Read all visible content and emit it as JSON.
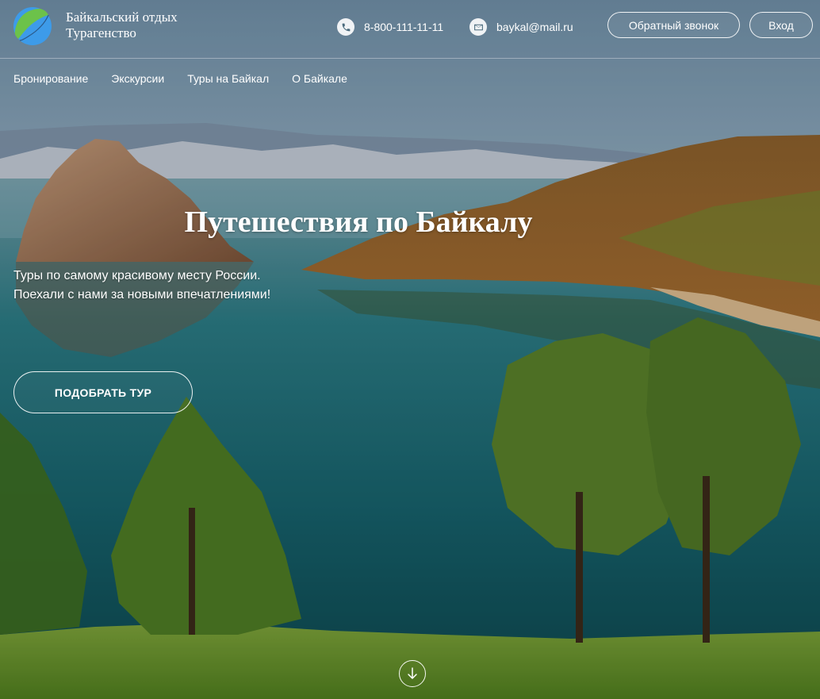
{
  "header": {
    "brand_line1": "Байкальский отдых",
    "brand_line2": "Турагенство",
    "phone": "8-800-111-11-11",
    "email": "baykal@mail.ru",
    "callback_label": "Обратный звонок",
    "login_label": "Вход",
    "icons": {
      "logo": "logo-icon",
      "phone": "phone-icon",
      "email": "email-icon"
    }
  },
  "nav": {
    "items": [
      {
        "label": "Бронирование"
      },
      {
        "label": "Экскурсии"
      },
      {
        "label": "Туры на Байкал"
      },
      {
        "label": "О Байкале"
      }
    ]
  },
  "hero": {
    "title": "Путешествия по Байкалу",
    "subtitle_line1": "Туры по самому красивому месту России.",
    "subtitle_line2": "Поехали с нами за новыми впечатлениями!",
    "cta_label": "ПОДОБРАТЬ ТУР",
    "scroll_icon": "arrow-down-icon"
  },
  "colors": {
    "logo_green": "#6cc24a",
    "logo_blue": "#3d9be9",
    "text": "#ffffff",
    "water": "#1f6f78",
    "grass": "#5c8f2a"
  }
}
